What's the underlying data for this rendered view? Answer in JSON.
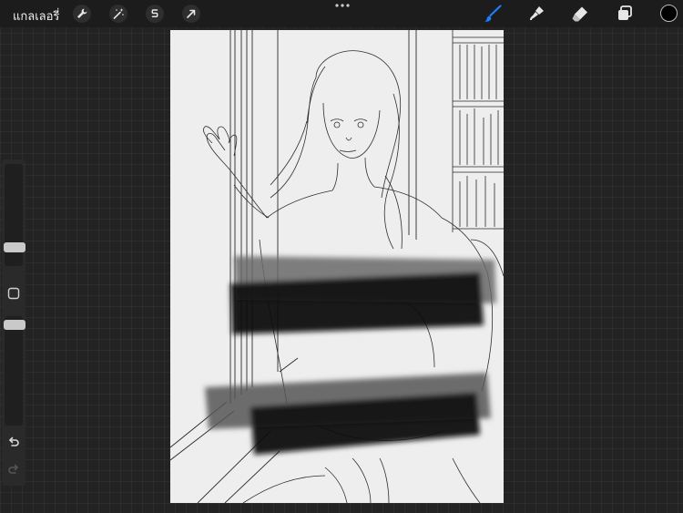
{
  "topbar": {
    "gallery_label": "แกลเลอรี่",
    "left_tools": [
      {
        "name": "wrench-icon"
      },
      {
        "name": "magic-wand-icon"
      },
      {
        "name": "selection-icon"
      },
      {
        "name": "transform-arrow-icon"
      }
    ],
    "right_tools": [
      {
        "name": "brush-icon",
        "active": true,
        "color": "#1f7cff"
      },
      {
        "name": "smudge-icon",
        "active": false
      },
      {
        "name": "eraser-icon",
        "active": false
      },
      {
        "name": "layers-icon",
        "active": false
      }
    ],
    "current_color": "#000000"
  },
  "sidebar": {
    "brush_size_level": 0.15,
    "opacity_level": 0.95
  },
  "colors": {
    "background": "#232323",
    "toolbar": "#1c1c1c",
    "accent": "#1f7cff",
    "canvas": "#eeeeee"
  }
}
